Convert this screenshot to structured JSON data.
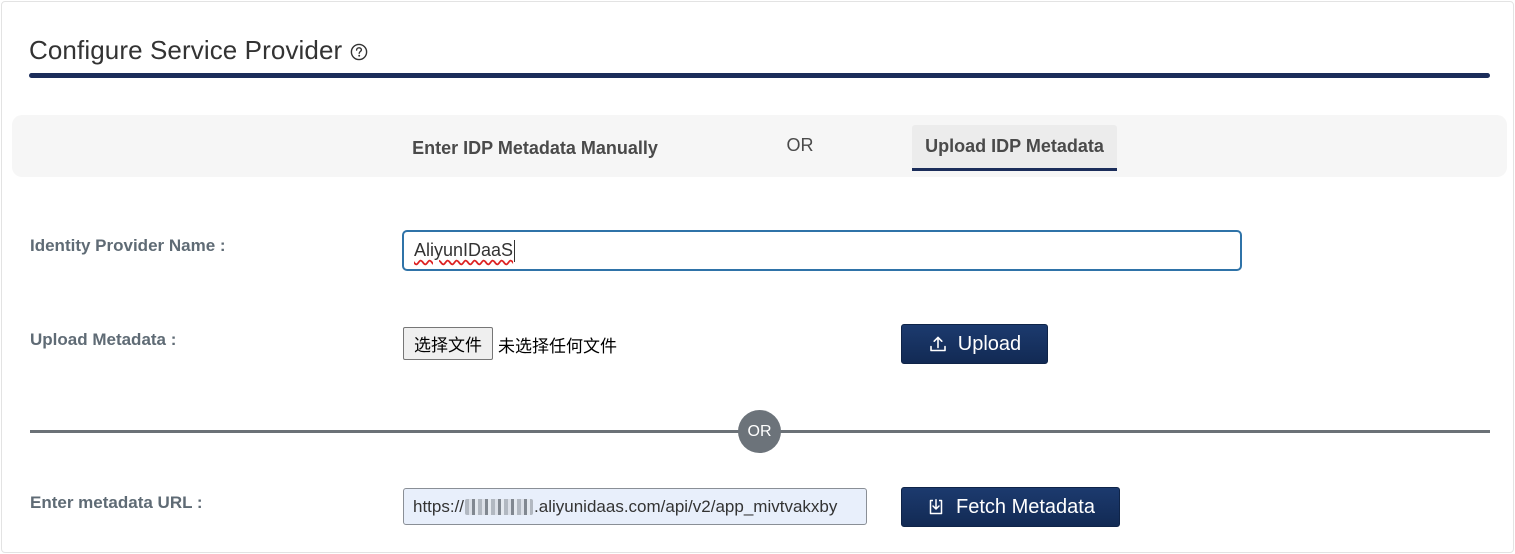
{
  "header": {
    "title": "Configure Service Provider",
    "help_icon": "question-circle-icon"
  },
  "tabs": {
    "manual_label": "Enter IDP Metadata Manually",
    "separator": "OR",
    "upload_label": "Upload IDP Metadata",
    "active": "Upload IDP Metadata"
  },
  "form": {
    "idp_name_label": "Identity Provider Name :",
    "idp_name_value": "AliyunIDaaS",
    "upload_label": "Upload Metadata :",
    "file_button_label": "选择文件",
    "file_status": "未选择任何文件",
    "upload_button_label": "Upload",
    "or_divider": "OR",
    "url_label": "Enter metadata URL :",
    "url_value_prefix": "https://",
    "url_value_suffix": ".aliyunidaas.com/api/v2/app_mivtvakxby",
    "fetch_button_label": "Fetch Metadata"
  },
  "colors": {
    "accent": "#1b2d5a",
    "button": "#16305d",
    "input_focus": "#2f73a8"
  }
}
